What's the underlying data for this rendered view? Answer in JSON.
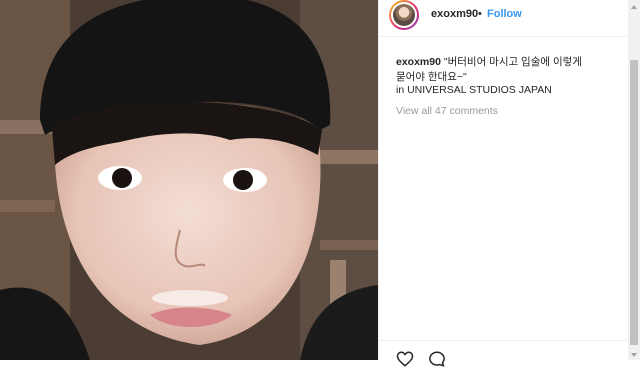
{
  "post": {
    "username": "exoxm90",
    "separator": "•",
    "follow_label": "Follow",
    "caption_user": "exoxm90",
    "caption_line1": "\"버터비어 마시고 입술에 이렇게",
    "caption_line2": "묻어야 한대요~\"",
    "location": "in UNIVERSAL STUDIOS JAPAN",
    "view_comments": "View all 47 comments"
  },
  "icons": {
    "like": "heart-icon",
    "comment": "comment-icon"
  },
  "colors": {
    "follow": "#3897f0",
    "muted": "#999999",
    "text": "#262626"
  }
}
